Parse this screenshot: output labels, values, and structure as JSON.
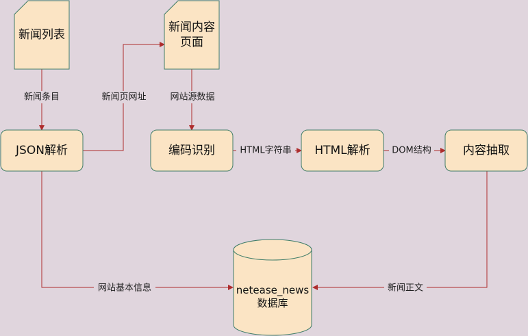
{
  "nodes": {
    "news_list": "新闻列表",
    "news_page_line1": "新闻内容",
    "news_page_line2": "页面",
    "json_parse": "JSON解析",
    "encoding_detect": "编码识别",
    "html_parse": "HTML解析",
    "content_extract": "内容抽取",
    "database_line1": "netease_news",
    "database_line2": "数据库"
  },
  "edges": {
    "news_items": "新闻条目",
    "news_page_url": "新闻页网址",
    "site_source_data": "网站源数据",
    "html_string": "HTML字符串",
    "dom_structure": "DOM结构",
    "site_basic_info": "网站基本信息",
    "news_body": "新闻正文"
  },
  "colors": {
    "background": "#e0d5dd",
    "node_fill": "#fbe4c4",
    "node_stroke": "#3f7c68",
    "edge": "#ae2d2d"
  }
}
